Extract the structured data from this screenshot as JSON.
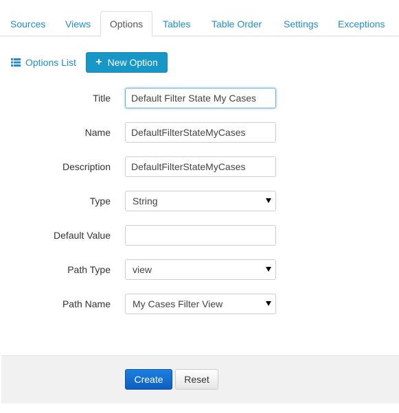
{
  "tabs": [
    {
      "label": "Sources"
    },
    {
      "label": "Views"
    },
    {
      "label": "Options",
      "active": true
    },
    {
      "label": "Tables"
    },
    {
      "label": "Table Order"
    },
    {
      "label": "Settings"
    },
    {
      "label": "Exceptions"
    }
  ],
  "toolbar": {
    "options_list_label": "Options List",
    "options_list_icon": "list-icon",
    "new_option_label": "New Option",
    "new_option_icon": "plus-icon"
  },
  "form": {
    "title": {
      "label": "Title",
      "value": "Default Filter State My Cases"
    },
    "name": {
      "label": "Name",
      "value": "DefaultFilterStateMyCases"
    },
    "description": {
      "label": "Description",
      "value": "DefaultFilterStateMyCases"
    },
    "type": {
      "label": "Type",
      "value": "String"
    },
    "default_value": {
      "label": "Default Value",
      "value": ""
    },
    "path_type": {
      "label": "Path Type",
      "value": "view"
    },
    "path_name": {
      "label": "Path Name",
      "value": "My Cases Filter View"
    }
  },
  "footer": {
    "create_label": "Create",
    "reset_label": "Reset"
  },
  "colors": {
    "link": "#1f8dd6",
    "primary_button": "#1797c7",
    "create_button": "#0e5fc0",
    "footer_background": "#f1f1f1"
  }
}
